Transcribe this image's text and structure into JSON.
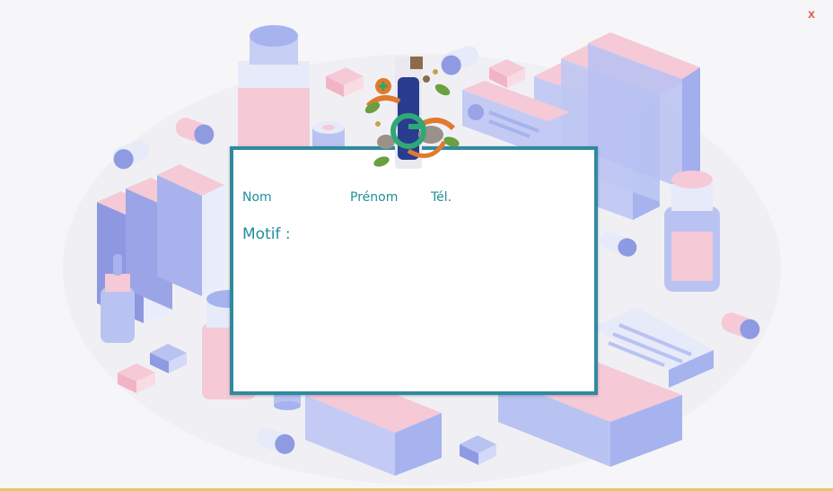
{
  "window": {
    "close_label": "x"
  },
  "form": {
    "nom_label": "Nom",
    "prenom_label": "Prénom",
    "tel_label": "Tél.",
    "motif_label": "Motif :"
  },
  "colors": {
    "accent": "#1f8f9b",
    "card_border": "#2f8aa0",
    "close": "#e0574a",
    "pink": "#f6c9d6",
    "lavender": "#b9c3f2",
    "periwinkle": "#8e9be3"
  }
}
